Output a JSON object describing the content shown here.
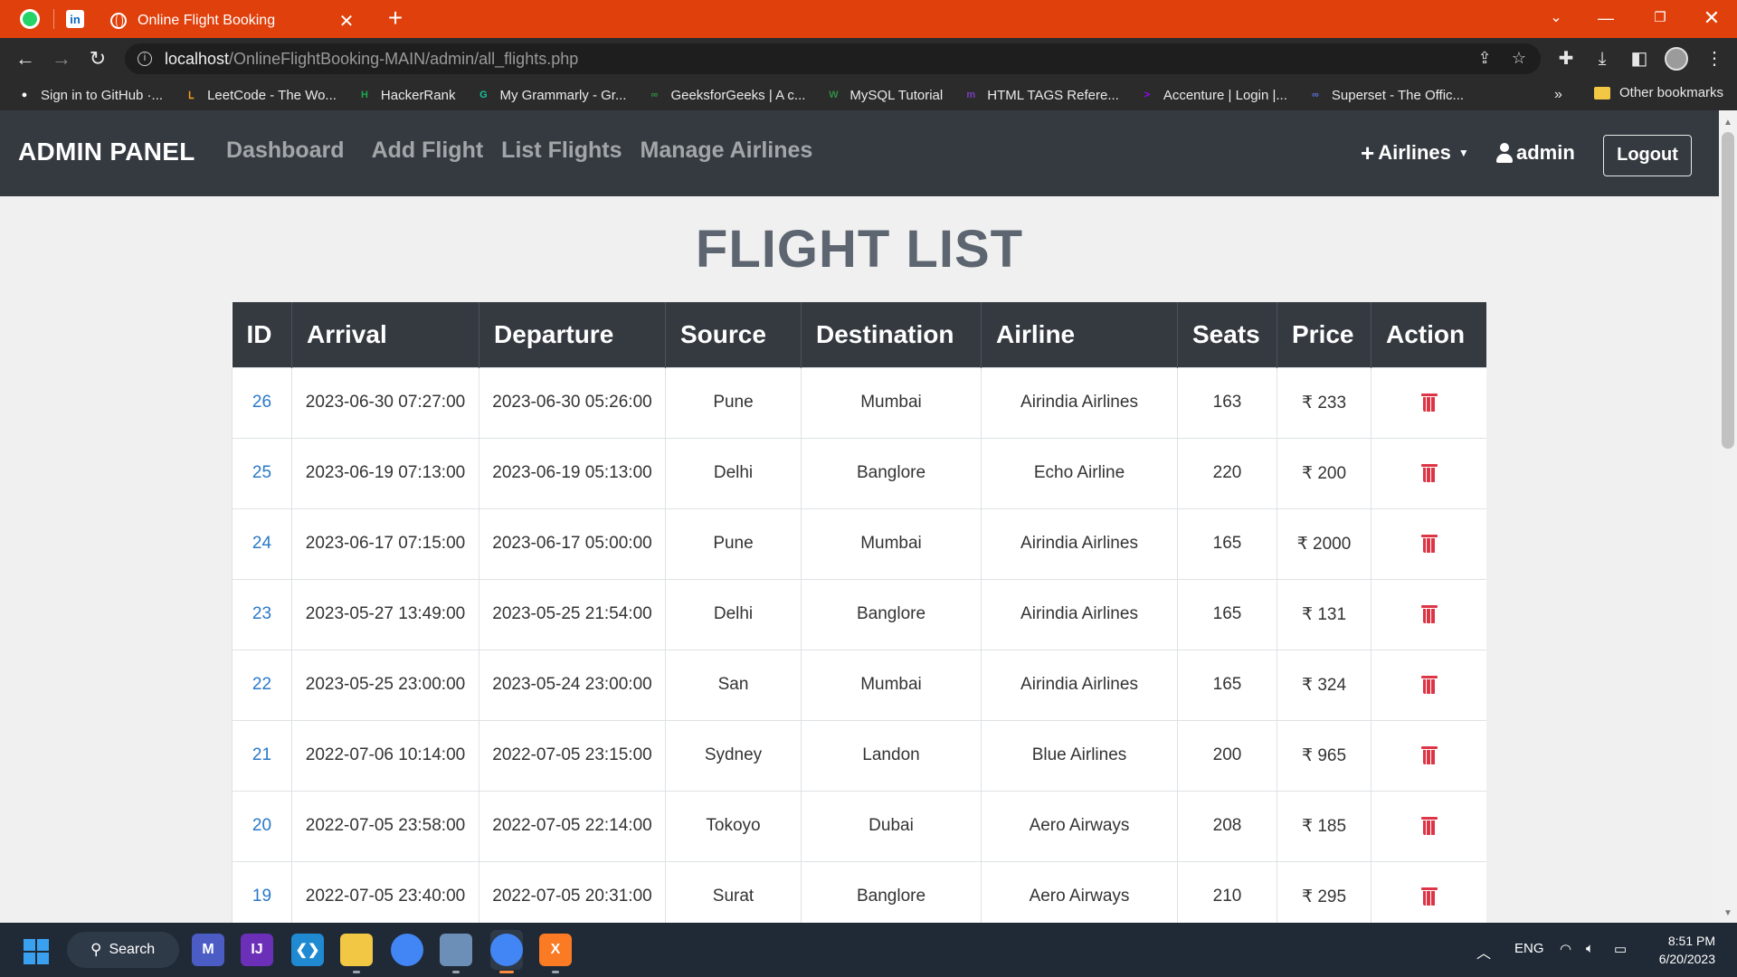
{
  "browser": {
    "tab_title": "Online Flight Booking",
    "url_host": "localhost",
    "url_path": "/OnlineFlightBooking-MAIN/admin/all_flights.php",
    "new_tab_symbol": "+",
    "bookmarks": [
      {
        "label": "Sign in to GitHub ·...",
        "icon": "github-icon",
        "color": "#ffffff"
      },
      {
        "label": "LeetCode - The Wo...",
        "icon": "leetcode-icon",
        "color": "#f89f1b"
      },
      {
        "label": "HackerRank",
        "icon": "hackerrank-icon",
        "color": "#1ba94c"
      },
      {
        "label": "My Grammarly - Gr...",
        "icon": "grammarly-icon",
        "color": "#15c39a"
      },
      {
        "label": "GeeksforGeeks | A c...",
        "icon": "geeksforgeeks-icon",
        "color": "#2f8d46"
      },
      {
        "label": "MySQL Tutorial",
        "icon": "mysql-icon",
        "color": "#2f8d46"
      },
      {
        "label": "HTML TAGS Refere...",
        "icon": "html-tags-icon",
        "color": "#7b3fbf"
      },
      {
        "label": "Accenture | Login |...",
        "icon": "accenture-icon",
        "color": "#a100ff"
      },
      {
        "label": "Superset - The Offic...",
        "icon": "superset-icon",
        "color": "#5a6fd8"
      }
    ],
    "bookmarks_more": "»",
    "other_bookmarks": "Other bookmarks"
  },
  "navbar": {
    "brand": "ADMIN PANEL",
    "links": [
      "Dashboard",
      "Add Flight",
      "List Flights",
      "Manage Airlines"
    ],
    "airlines_label": "Airlines",
    "user_label": "admin",
    "logout_label": "Logout"
  },
  "page": {
    "title": "FLIGHT LIST",
    "columns": [
      "ID",
      "Arrival",
      "Departure",
      "Source",
      "Destination",
      "Airline",
      "Seats",
      "Price",
      "Action"
    ],
    "currency_symbol": "₹",
    "rows": [
      {
        "id": "26",
        "arrival": "2023-06-30 07:27:00",
        "departure": "2023-06-30 05:26:00",
        "source": "Pune",
        "destination": "Mumbai",
        "airline": "Airindia Airlines",
        "seats": "163",
        "price": "233"
      },
      {
        "id": "25",
        "arrival": "2023-06-19 07:13:00",
        "departure": "2023-06-19 05:13:00",
        "source": "Delhi",
        "destination": "Banglore",
        "airline": "Echo Airline",
        "seats": "220",
        "price": "200"
      },
      {
        "id": "24",
        "arrival": "2023-06-17 07:15:00",
        "departure": "2023-06-17 05:00:00",
        "source": "Pune",
        "destination": "Mumbai",
        "airline": "Airindia Airlines",
        "seats": "165",
        "price": "2000"
      },
      {
        "id": "23",
        "arrival": "2023-05-27 13:49:00",
        "departure": "2023-05-25 21:54:00",
        "source": "Delhi",
        "destination": "Banglore",
        "airline": "Airindia Airlines",
        "seats": "165",
        "price": "131"
      },
      {
        "id": "22",
        "arrival": "2023-05-25 23:00:00",
        "departure": "2023-05-24 23:00:00",
        "source": "San",
        "destination": "Mumbai",
        "airline": "Airindia Airlines",
        "seats": "165",
        "price": "324"
      },
      {
        "id": "21",
        "arrival": "2022-07-06 10:14:00",
        "departure": "2022-07-05 23:15:00",
        "source": "Sydney",
        "destination": "Landon",
        "airline": "Blue Airlines",
        "seats": "200",
        "price": "965"
      },
      {
        "id": "20",
        "arrival": "2022-07-05 23:58:00",
        "departure": "2022-07-05 22:14:00",
        "source": "Tokoyo",
        "destination": "Dubai",
        "airline": "Aero Airways",
        "seats": "208",
        "price": "185"
      },
      {
        "id": "19",
        "arrival": "2022-07-05 23:40:00",
        "departure": "2022-07-05 20:31:00",
        "source": "Surat",
        "destination": "Banglore",
        "airline": "Aero Airways",
        "seats": "210",
        "price": "295"
      }
    ]
  },
  "taskbar": {
    "search_label": "Search",
    "apps": [
      {
        "name": "word-app-icon",
        "glyph": "M",
        "color": "#4b5cc4"
      },
      {
        "name": "intellij-icon",
        "glyph": "IJ",
        "color": "#6b2fb8"
      },
      {
        "name": "vscode-icon",
        "glyph": "❮❯",
        "color": "#1f8ad2"
      },
      {
        "name": "file-explorer-icon",
        "glyph": "",
        "color": "#f2c744"
      },
      {
        "name": "chrome-icon",
        "glyph": "",
        "color": "#4285f4"
      },
      {
        "name": "photos-icon",
        "glyph": "",
        "color": "#6c8fb8"
      },
      {
        "name": "chrome-profile-icon",
        "glyph": "",
        "color": "#4285f4"
      },
      {
        "name": "xampp-icon",
        "glyph": "X",
        "color": "#fb7a24"
      }
    ],
    "language": "ENG",
    "time": "8:51 PM",
    "date": "6/20/2023"
  }
}
